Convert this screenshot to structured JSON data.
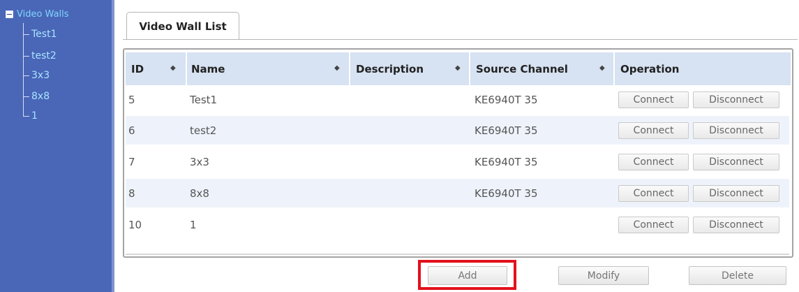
{
  "tree": {
    "root_label": "Video Walls",
    "items": [
      {
        "label": "Test1"
      },
      {
        "label": "test2"
      },
      {
        "label": "3x3"
      },
      {
        "label": "8x8"
      },
      {
        "label": "1"
      }
    ]
  },
  "tab": {
    "label": "Video Wall List"
  },
  "table": {
    "columns": [
      "ID",
      "Name",
      "Description",
      "Source Channel",
      "Operation"
    ],
    "rows": [
      {
        "id": "5",
        "name": "Test1",
        "description": "",
        "source_channel": "KE6940T 35",
        "connect": "Connect",
        "disconnect": "Disconnect"
      },
      {
        "id": "6",
        "name": "test2",
        "description": "",
        "source_channel": "KE6940T 35",
        "connect": "Connect",
        "disconnect": "Disconnect"
      },
      {
        "id": "7",
        "name": "3x3",
        "description": "",
        "source_channel": "KE6940T 35",
        "connect": "Connect",
        "disconnect": "Disconnect"
      },
      {
        "id": "8",
        "name": "8x8",
        "description": "",
        "source_channel": "KE6940T 35",
        "connect": "Connect",
        "disconnect": "Disconnect"
      },
      {
        "id": "10",
        "name": "1",
        "description": "",
        "source_channel": "",
        "connect": "Connect",
        "disconnect": "Disconnect"
      }
    ]
  },
  "actions": {
    "add": "Add",
    "modify": "Modify",
    "delete": "Delete"
  },
  "icons": {
    "sort": "sort-icon",
    "collapse": "minus-icon"
  },
  "colors": {
    "sidebar": "#4a66b7",
    "highlight": "#e3101c",
    "header": "#d7e2f2"
  }
}
